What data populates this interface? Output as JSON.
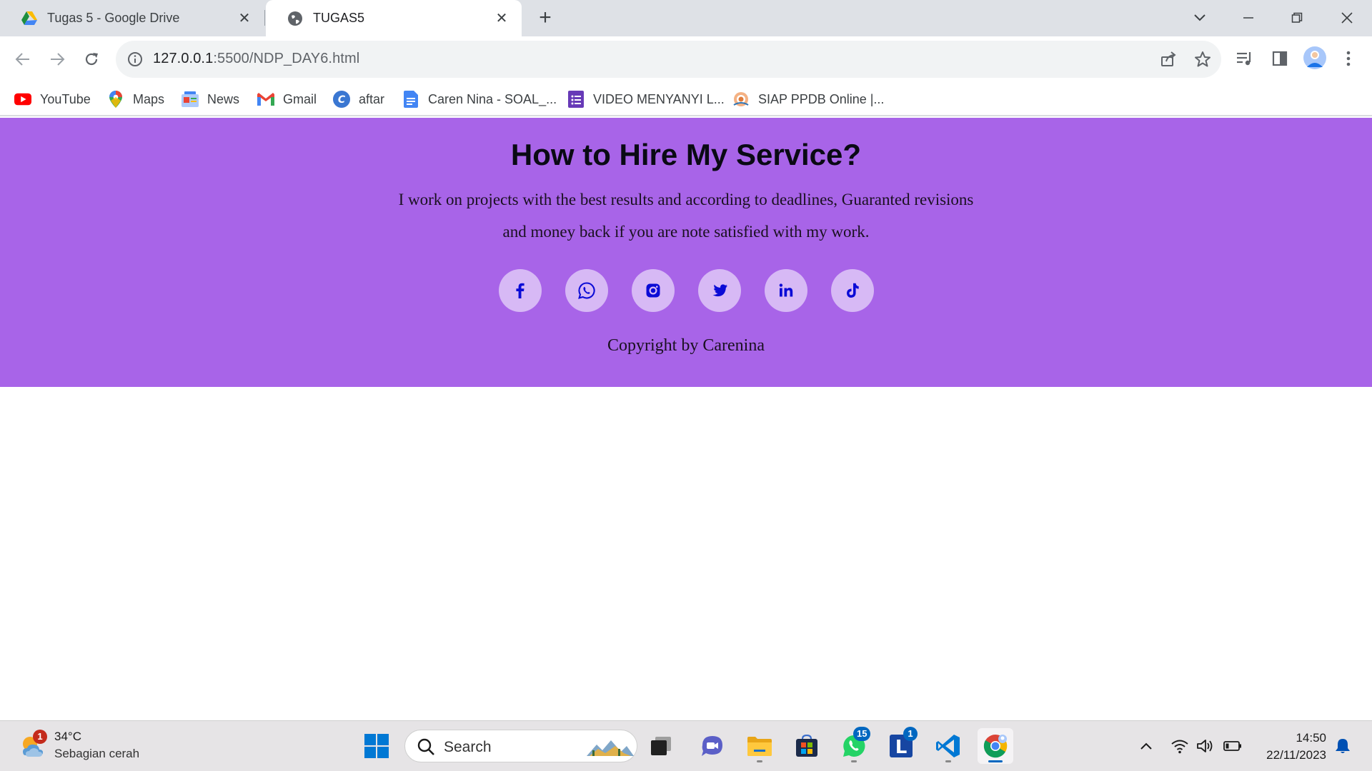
{
  "browser": {
    "tabs": [
      {
        "title": "Tugas 5 - Google Drive",
        "active": false
      },
      {
        "title": "TUGAS5",
        "active": true
      }
    ],
    "url_host": "127.0.0.1",
    "url_rest": ":5500/NDP_DAY6.html",
    "bookmarks": [
      {
        "label": "YouTube",
        "icon": "youtube-icon"
      },
      {
        "label": "Maps",
        "icon": "maps-icon"
      },
      {
        "label": "News",
        "icon": "news-icon"
      },
      {
        "label": "Gmail",
        "icon": "gmail-icon"
      },
      {
        "label": "aftar",
        "icon": "canva-icon"
      },
      {
        "label": "Caren Nina - SOAL_...",
        "icon": "docs-icon"
      },
      {
        "label": "VIDEO MENYANYI L...",
        "icon": "forms-icon"
      },
      {
        "label": "SIAP PPDB Online |...",
        "icon": "ppdb-icon"
      }
    ]
  },
  "page": {
    "title": "How to Hire My Service?",
    "description_line1": "I work on projects with the best results and according to deadlines, Guaranted revisions",
    "description_line2": "and money back if you are note satisfied with my work.",
    "socials": [
      "facebook-icon",
      "whatsapp-icon",
      "instagram-icon",
      "twitter-icon",
      "linkedin-icon",
      "tiktok-icon"
    ],
    "copyright": "Copyright by Carenina",
    "hero_color": "#a864e8",
    "icon_bg": "#d7b9f5",
    "icon_color": "#0b0bd6"
  },
  "taskbar": {
    "weather_badge": "1",
    "temperature": "34°C",
    "condition": "Sebagian cerah",
    "search_label": "Search",
    "whatsapp_badge": "15",
    "l_app_badge": "1",
    "time": "14:50",
    "date": "22/11/2023"
  }
}
